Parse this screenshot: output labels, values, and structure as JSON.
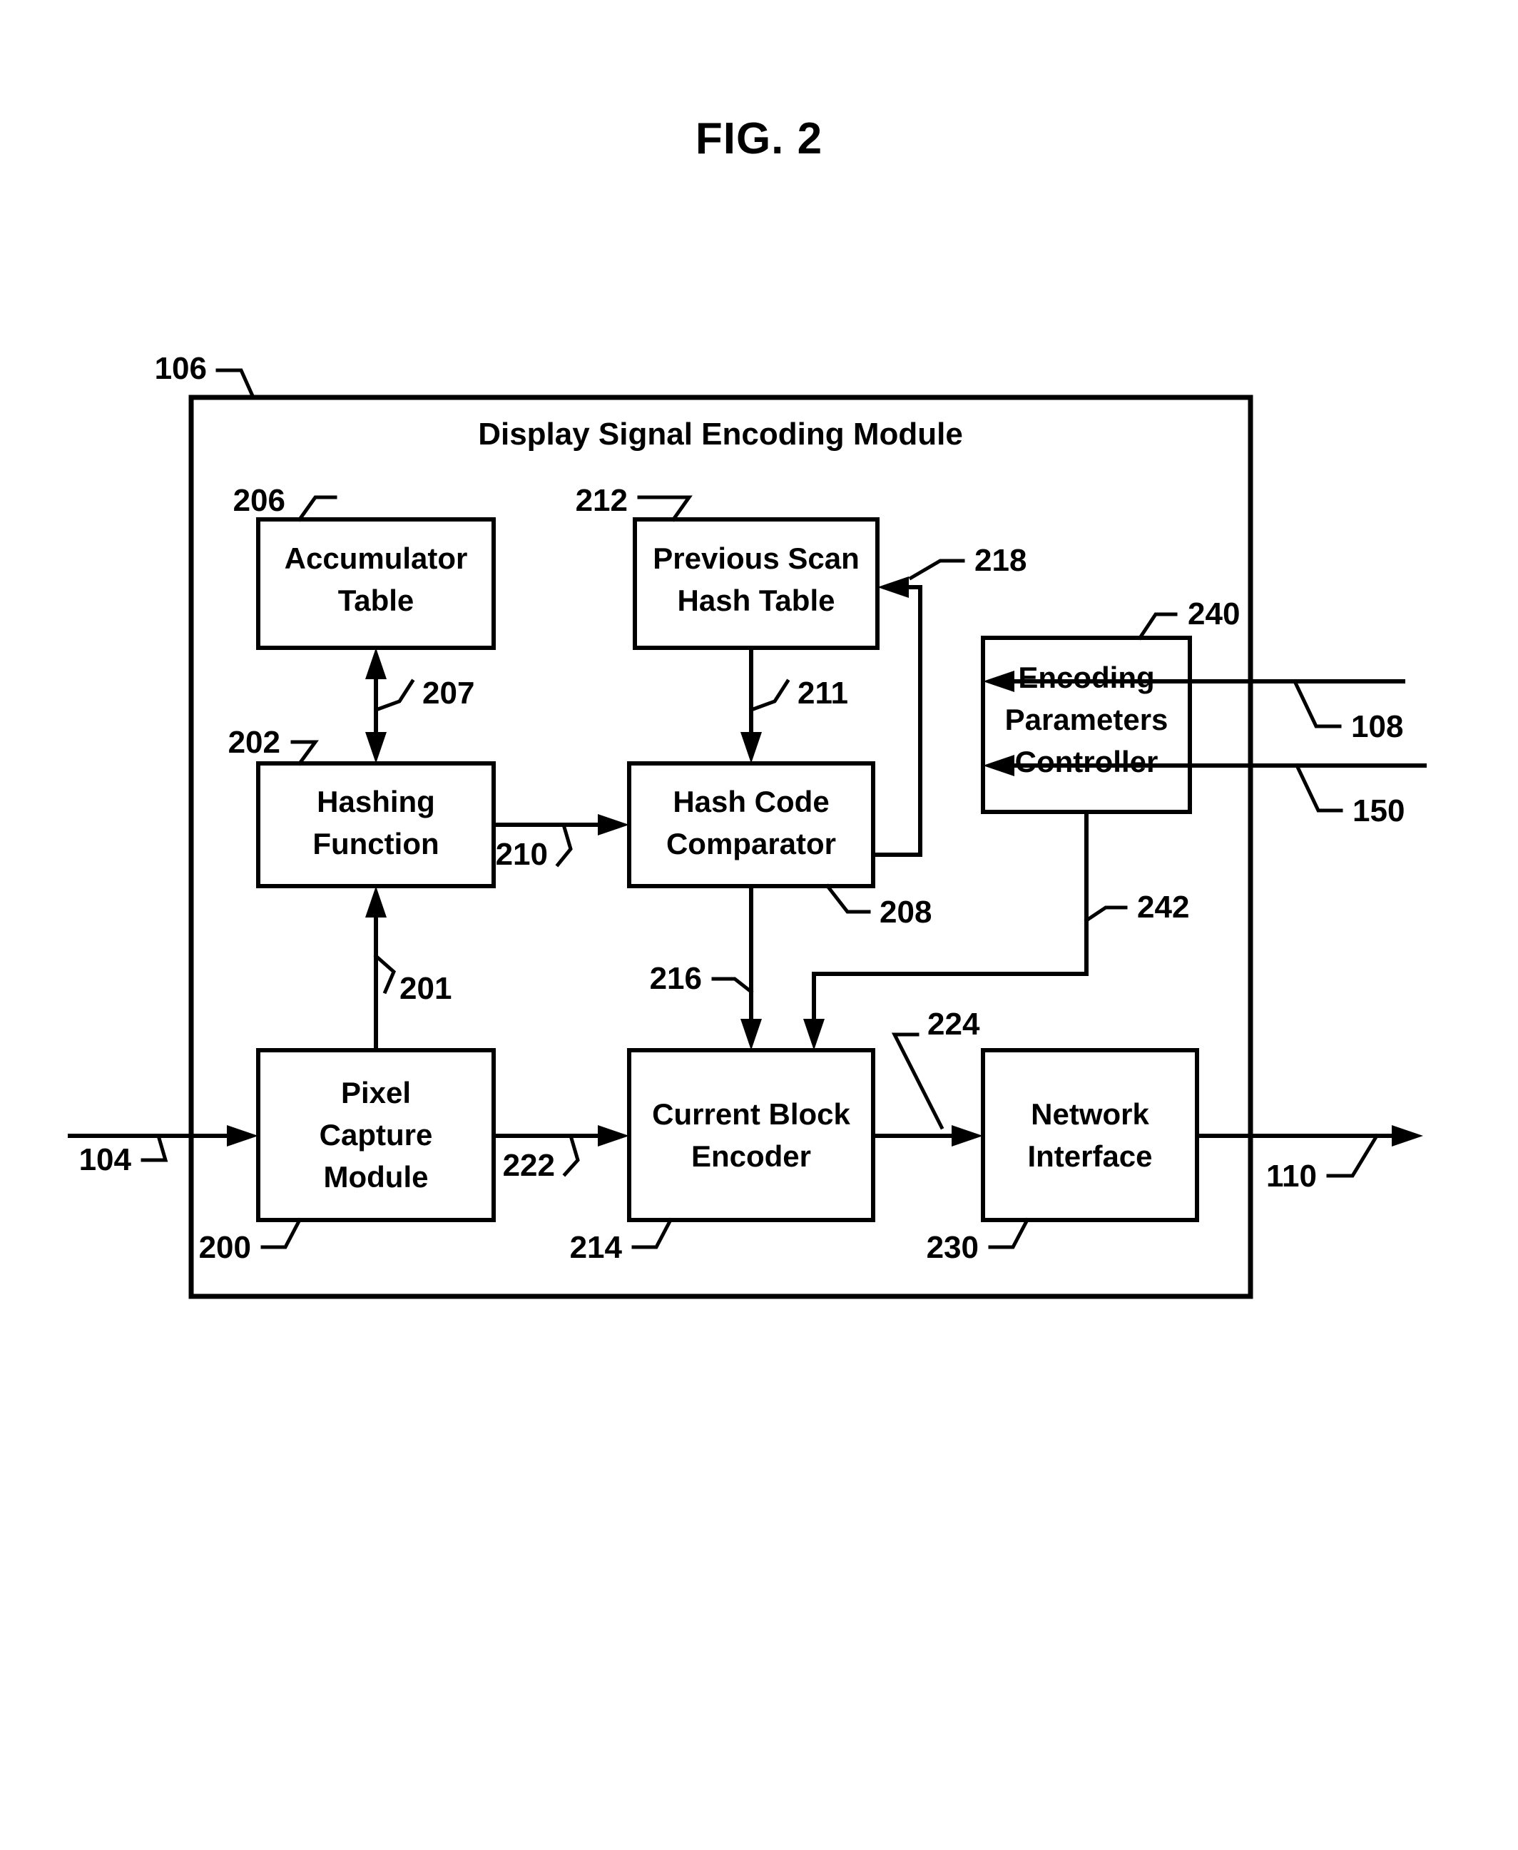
{
  "figure": {
    "title": "FIG. 2",
    "module": {
      "ref": "106",
      "title": "Display Signal Encoding Module"
    }
  },
  "blocks": [
    {
      "id": "accumulator-table",
      "ref": "206",
      "lines": [
        "Accumulator",
        "Table"
      ]
    },
    {
      "id": "previous-scan-hash-table",
      "ref": "212",
      "lines": [
        "Previous Scan",
        "Hash Table"
      ]
    },
    {
      "id": "encoding-parameters-controller",
      "ref": "240",
      "lines": [
        "Encoding",
        "Parameters",
        "Controller"
      ]
    },
    {
      "id": "hashing-function",
      "ref": "202",
      "lines": [
        "Hashing",
        "Function"
      ]
    },
    {
      "id": "hash-code-comparator",
      "ref": "208",
      "lines": [
        "Hash Code",
        "Comparator"
      ]
    },
    {
      "id": "pixel-capture-module",
      "ref": "200",
      "lines": [
        "Pixel",
        "Capture",
        "Module"
      ]
    },
    {
      "id": "current-block-encoder",
      "ref": "214",
      "lines": [
        "Current Block",
        "Encoder"
      ]
    },
    {
      "id": "network-interface",
      "ref": "230",
      "lines": [
        "Network",
        "Interface"
      ]
    }
  ],
  "connectors": [
    {
      "id": "pixel-to-hashing",
      "ref": "201"
    },
    {
      "id": "accumulator-hashing-bidir",
      "ref": "207"
    },
    {
      "id": "hashtable-to-comparator",
      "ref": "211"
    },
    {
      "id": "hashing-to-comparator",
      "ref": "210"
    },
    {
      "id": "comparator-to-hashtable-feedback",
      "ref": "218"
    },
    {
      "id": "comparator-to-encoder",
      "ref": "216"
    },
    {
      "id": "pixel-to-encoder",
      "ref": "222"
    },
    {
      "id": "encoder-to-network",
      "ref": "224"
    },
    {
      "id": "controller-to-encoder",
      "ref": "242"
    },
    {
      "id": "display-signal-input",
      "ref": "104"
    },
    {
      "id": "controller-input-upper",
      "ref": "108"
    },
    {
      "id": "controller-input-lower",
      "ref": "150"
    },
    {
      "id": "network-output",
      "ref": "110"
    }
  ],
  "refs": {
    "r104": "104",
    "r106": "106",
    "r108": "108",
    "r110": "110",
    "r150": "150",
    "r200": "200",
    "r201": "201",
    "r202": "202",
    "r206": "206",
    "r207": "207",
    "r208": "208",
    "r210": "210",
    "r211": "211",
    "r212": "212",
    "r214": "214",
    "r216": "216",
    "r218": "218",
    "r222": "222",
    "r224": "224",
    "r230": "230",
    "r240": "240",
    "r242": "242"
  },
  "labels": {
    "accumulator_l1": "Accumulator",
    "accumulator_l2": "Table",
    "prevscan_l1": "Previous Scan",
    "prevscan_l2": "Hash Table",
    "epc_l1": "Encoding",
    "epc_l2": "Parameters",
    "epc_l3": "Controller",
    "hashing_l1": "Hashing",
    "hashing_l2": "Function",
    "comparator_l1": "Hash Code",
    "comparator_l2": "Comparator",
    "pixel_l1": "Pixel",
    "pixel_l2": "Capture",
    "pixel_l3": "Module",
    "encoder_l1": "Current Block",
    "encoder_l2": "Encoder",
    "network_l1": "Network",
    "network_l2": "Interface"
  }
}
